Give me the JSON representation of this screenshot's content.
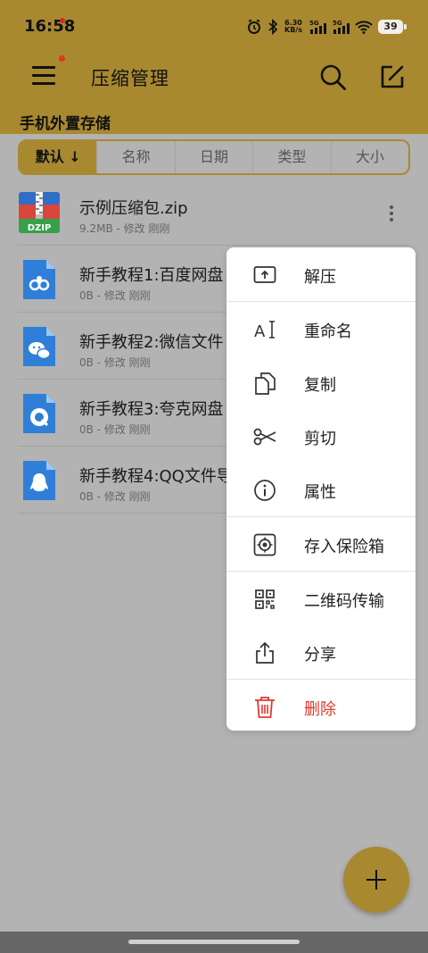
{
  "status_bar": {
    "time": "16:58",
    "network_speed_value": "6.30",
    "network_speed_unit": "KB/s",
    "signal1_label": "5G",
    "signal2_label": "5G",
    "battery": "39"
  },
  "app_bar": {
    "title": "压缩管理",
    "storage_label": "手机外置存储"
  },
  "sort_tabs": [
    "默认 ↓",
    "名称",
    "日期",
    "类型",
    "大小"
  ],
  "files": [
    {
      "name": "示例压缩包.zip",
      "meta": "9.2MB - 修改 刚刚",
      "icon": "dzip-archive-icon",
      "icon_text": "DZIP"
    },
    {
      "name": "新手教程1:百度网盘",
      "meta": "0B - 修改 刚刚",
      "icon": "baidu-netdisk-doc-icon"
    },
    {
      "name": "新手教程2:微信文件",
      "meta": "0B - 修改 刚刚",
      "icon": "wechat-doc-icon"
    },
    {
      "name": "新手教程3:夸克网盘",
      "meta": "0B - 修改 刚刚",
      "icon": "quark-doc-icon"
    },
    {
      "name": "新手教程4:QQ文件导",
      "meta": "0B - 修改 刚刚",
      "icon": "qq-doc-icon"
    }
  ],
  "context_menu": {
    "items": [
      {
        "label": "解压",
        "icon": "extract-icon"
      },
      {
        "label": "重命名",
        "icon": "rename-icon"
      },
      {
        "label": "复制",
        "icon": "copy-icon"
      },
      {
        "label": "剪切",
        "icon": "scissors-icon"
      },
      {
        "label": "属性",
        "icon": "info-icon"
      },
      {
        "label": "存入保险箱",
        "icon": "vault-icon"
      },
      {
        "label": "二维码传输",
        "icon": "qr-code-icon"
      },
      {
        "label": "分享",
        "icon": "share-icon"
      },
      {
        "label": "删除",
        "icon": "trash-icon"
      }
    ]
  },
  "colors": {
    "accent": "#a88930",
    "danger": "#e0392f",
    "file_icon_blue": "#2f7fd8",
    "dzip_blue": "#2f6fc7",
    "dzip_red": "#d9463c",
    "dzip_green": "#36a04a"
  }
}
